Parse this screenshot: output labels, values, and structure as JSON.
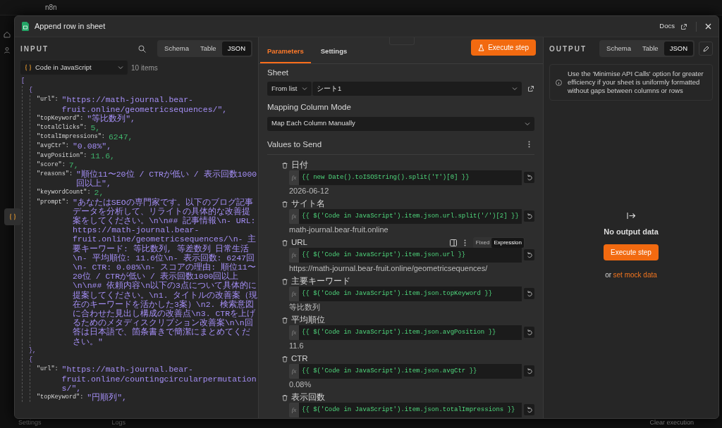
{
  "app": {
    "brand": "n8n",
    "footer_settings": "Settings",
    "logs_tab": "Logs",
    "clear_execution": "Clear execution"
  },
  "modal": {
    "title": "Append row in sheet",
    "docs_link": "Docs"
  },
  "input": {
    "heading": "INPUT",
    "view_tabs": [
      {
        "label": "Schema",
        "selected": false
      },
      {
        "label": "Table",
        "selected": false
      },
      {
        "label": "JSON",
        "selected": true
      }
    ],
    "source": "Code in JavaScript",
    "item_count": "10 items",
    "json": {
      "open": "[",
      "items": [
        {
          "open": "{",
          "close": "},",
          "fields": [
            {
              "key": "\"url\":",
              "kind": "string",
              "value": "\"https://math-journal.bear-fruit.online/geometricsequences/\","
            },
            {
              "key": "\"topKeyword\":",
              "kind": "string",
              "value": "\"等比数列\","
            },
            {
              "key": "\"totalClicks\":",
              "kind": "number",
              "value": "5,"
            },
            {
              "key": "\"totalImpressions\":",
              "kind": "number",
              "value": "6247,"
            },
            {
              "key": "\"avgCtr\":",
              "kind": "string",
              "value": "\"0.08%\","
            },
            {
              "key": "\"avgPosition\":",
              "kind": "number",
              "value": "11.6,"
            },
            {
              "key": "\"score\":",
              "kind": "number",
              "value": "7,"
            },
            {
              "key": "\"reasons\":",
              "kind": "string",
              "value": "\"順位11〜20位 / CTRが低い / 表示回数1000回以上\","
            },
            {
              "key": "\"keywordCount\":",
              "kind": "number",
              "value": "2,"
            },
            {
              "key": "\"prompt\":",
              "kind": "string",
              "value": "\"あなたはSEOの専門家です。以下のブログ記事データを分析して、リライトの具体的な改善提案をしてください。\\n\\n## 記事情報\\n- URL: https://math-journal.bear-fruit.online/geometricsequences/\\n- 主要キーワード: 等比数列, 等差数列 日常生活\\n- 平均順位: 11.6位\\n- 表示回数: 6247回\\n- CTR: 0.08%\\n- スコアの理由: 順位11〜20位 / CTRが低い / 表示回数1000回以上\\n\\n## 依頼内容\\n以下の3点について具体的に提案してください。\\n1. タイトルの改善案（現在のキーワードを活かした3案）\\n2. 検索意図に合わせた見出し構成の改善点\\n3. CTRを上げるためのメタディスクリプション改善案\\n\\n回答は日本語で、箇条書きで簡潔にまとめてください。\""
            }
          ]
        },
        {
          "open": "{",
          "fields": [
            {
              "key": "\"url\":",
              "kind": "string",
              "value": "\"https://math-journal.bear-fruit.online/countingcircularpermutations/\","
            },
            {
              "key": "\"topKeyword\":",
              "kind": "string",
              "value": "\"円順列\","
            }
          ]
        }
      ]
    }
  },
  "parameters": {
    "tabs": [
      {
        "label": "Parameters",
        "selected": true
      },
      {
        "label": "Settings",
        "selected": false
      }
    ],
    "execute_button": "Execute step",
    "sheet": {
      "label": "Sheet",
      "mode": "From list",
      "value": "シート1"
    },
    "mapping": {
      "label": "Mapping Column Mode",
      "value": "Map Each Column Manually"
    },
    "values": {
      "heading": "Values to Send",
      "fields": [
        {
          "label": "日付",
          "marker": "fx",
          "expression": "{{ new Date().toISOString().split('T')[0] }}",
          "result": "2026-06-12"
        },
        {
          "label": "サイト名",
          "marker": "fx",
          "expression": "{{ $('Code in JavaScript').item.json.url.split('/')[2] }}",
          "result": "math-journal.bear-fruit.online"
        },
        {
          "label": "URL",
          "marker": "fx",
          "expression": "{{ $('Code in JavaScript').item.json.url }}",
          "result": "https://math-journal.bear-fruit.online/geometricsequences/",
          "mode_toggle": [
            {
              "label": "Fixed",
              "selected": false
            },
            {
              "label": "Expression",
              "selected": true
            }
          ]
        },
        {
          "label": "主要キーワード",
          "marker": "fx",
          "expression": "{{ $('Code in JavaScript').item.json.topKeyword }}",
          "result": "等比数列"
        },
        {
          "label": "平均順位",
          "marker": "fx",
          "expression": "{{ $('Code in JavaScript').item.json.avgPosition }}",
          "result": "11.6"
        },
        {
          "label": "CTR",
          "marker": "fx",
          "expression": "{{ $('Code in JavaScript').item.json.avgCtr }}",
          "result": "0.08%"
        },
        {
          "label": "表示回数",
          "marker": "fx",
          "expression": "{{ $('Code in JavaScript').item.json.totalImpressions }}"
        }
      ]
    }
  },
  "output": {
    "heading": "OUTPUT",
    "view_tabs": [
      {
        "label": "Schema",
        "selected": false
      },
      {
        "label": "Table",
        "selected": false
      },
      {
        "label": "JSON",
        "selected": true
      }
    ],
    "notice": "Use the 'Minimise API Calls' option for greater efficiency if your sheet is uniformly formatted without gaps between columns or rows",
    "empty_title": "No output data",
    "execute_button": "Execute step",
    "mock_prefix": "or",
    "mock_link": "set mock data"
  }
}
